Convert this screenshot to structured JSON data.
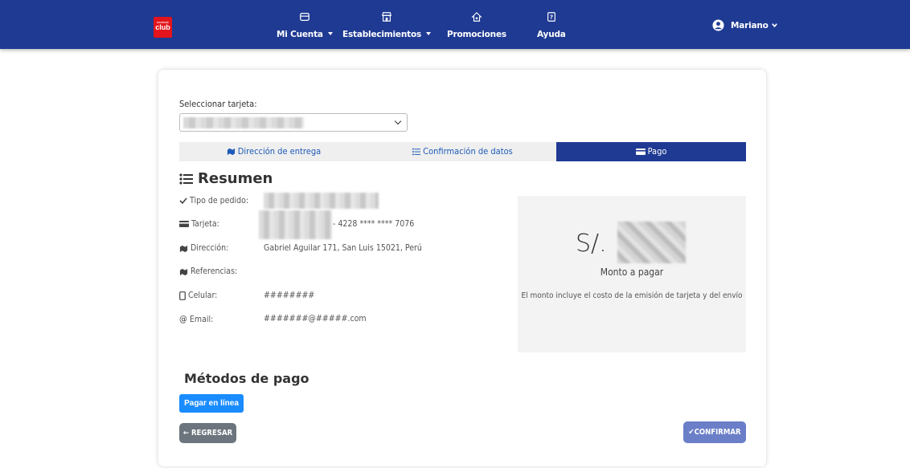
{
  "nav": {
    "logo_top": "oechsle",
    "logo_main": "club",
    "items": [
      {
        "label": "Mi Cuenta",
        "icon": "wallet-icon",
        "dropdown": true
      },
      {
        "label": "Establecimientos",
        "icon": "store-icon",
        "dropdown": true
      },
      {
        "label": "Promociones",
        "icon": "promotion-tag-icon",
        "dropdown": false
      },
      {
        "label": "Ayuda",
        "icon": "help-icon",
        "dropdown": false
      }
    ],
    "user": {
      "name": "Mariano",
      "icon": "user-circle-icon"
    },
    "color": "#1f3a93"
  },
  "form": {
    "select_label": "Seleccionar tarjeta:",
    "select_value": ""
  },
  "steps": [
    {
      "label": "Dirección de entrega",
      "icon": "map-icon",
      "active": false
    },
    {
      "label": "Confirmación de datos",
      "icon": "list-icon",
      "active": false
    },
    {
      "label": "Pago",
      "icon": "card-icon",
      "active": true
    }
  ],
  "summary": {
    "title": "Resumen",
    "rows": [
      {
        "label": "Tipo de pedido:",
        "icon": "check-icon",
        "value": ""
      },
      {
        "label": "Tarjeta:",
        "icon": "credit-card-icon",
        "value": "- 4228 **** **** 7076"
      },
      {
        "label": "Dirección:",
        "icon": "map-icon",
        "value": "Gabriel Aguilar 171, San Luis 15021, Perú"
      },
      {
        "label": "Referencias:",
        "icon": "map-icon",
        "value": ""
      },
      {
        "label": "Celular:",
        "icon": "phone-icon",
        "value": "########"
      },
      {
        "label": "Email:",
        "icon": "at-icon",
        "value": "#######@#####.com"
      }
    ]
  },
  "payment": {
    "currency": "S/.",
    "amount_label": "Monto a pagar",
    "note": "El monto incluye el costo de la emisión de tarjeta y del envío"
  },
  "methods": {
    "title": "Métodos de pago",
    "online_button": "Pagar en línea"
  },
  "actions": {
    "back": "REGRESAR",
    "confirm": "CONFIRMAR",
    "accent": "#1a8cff"
  }
}
